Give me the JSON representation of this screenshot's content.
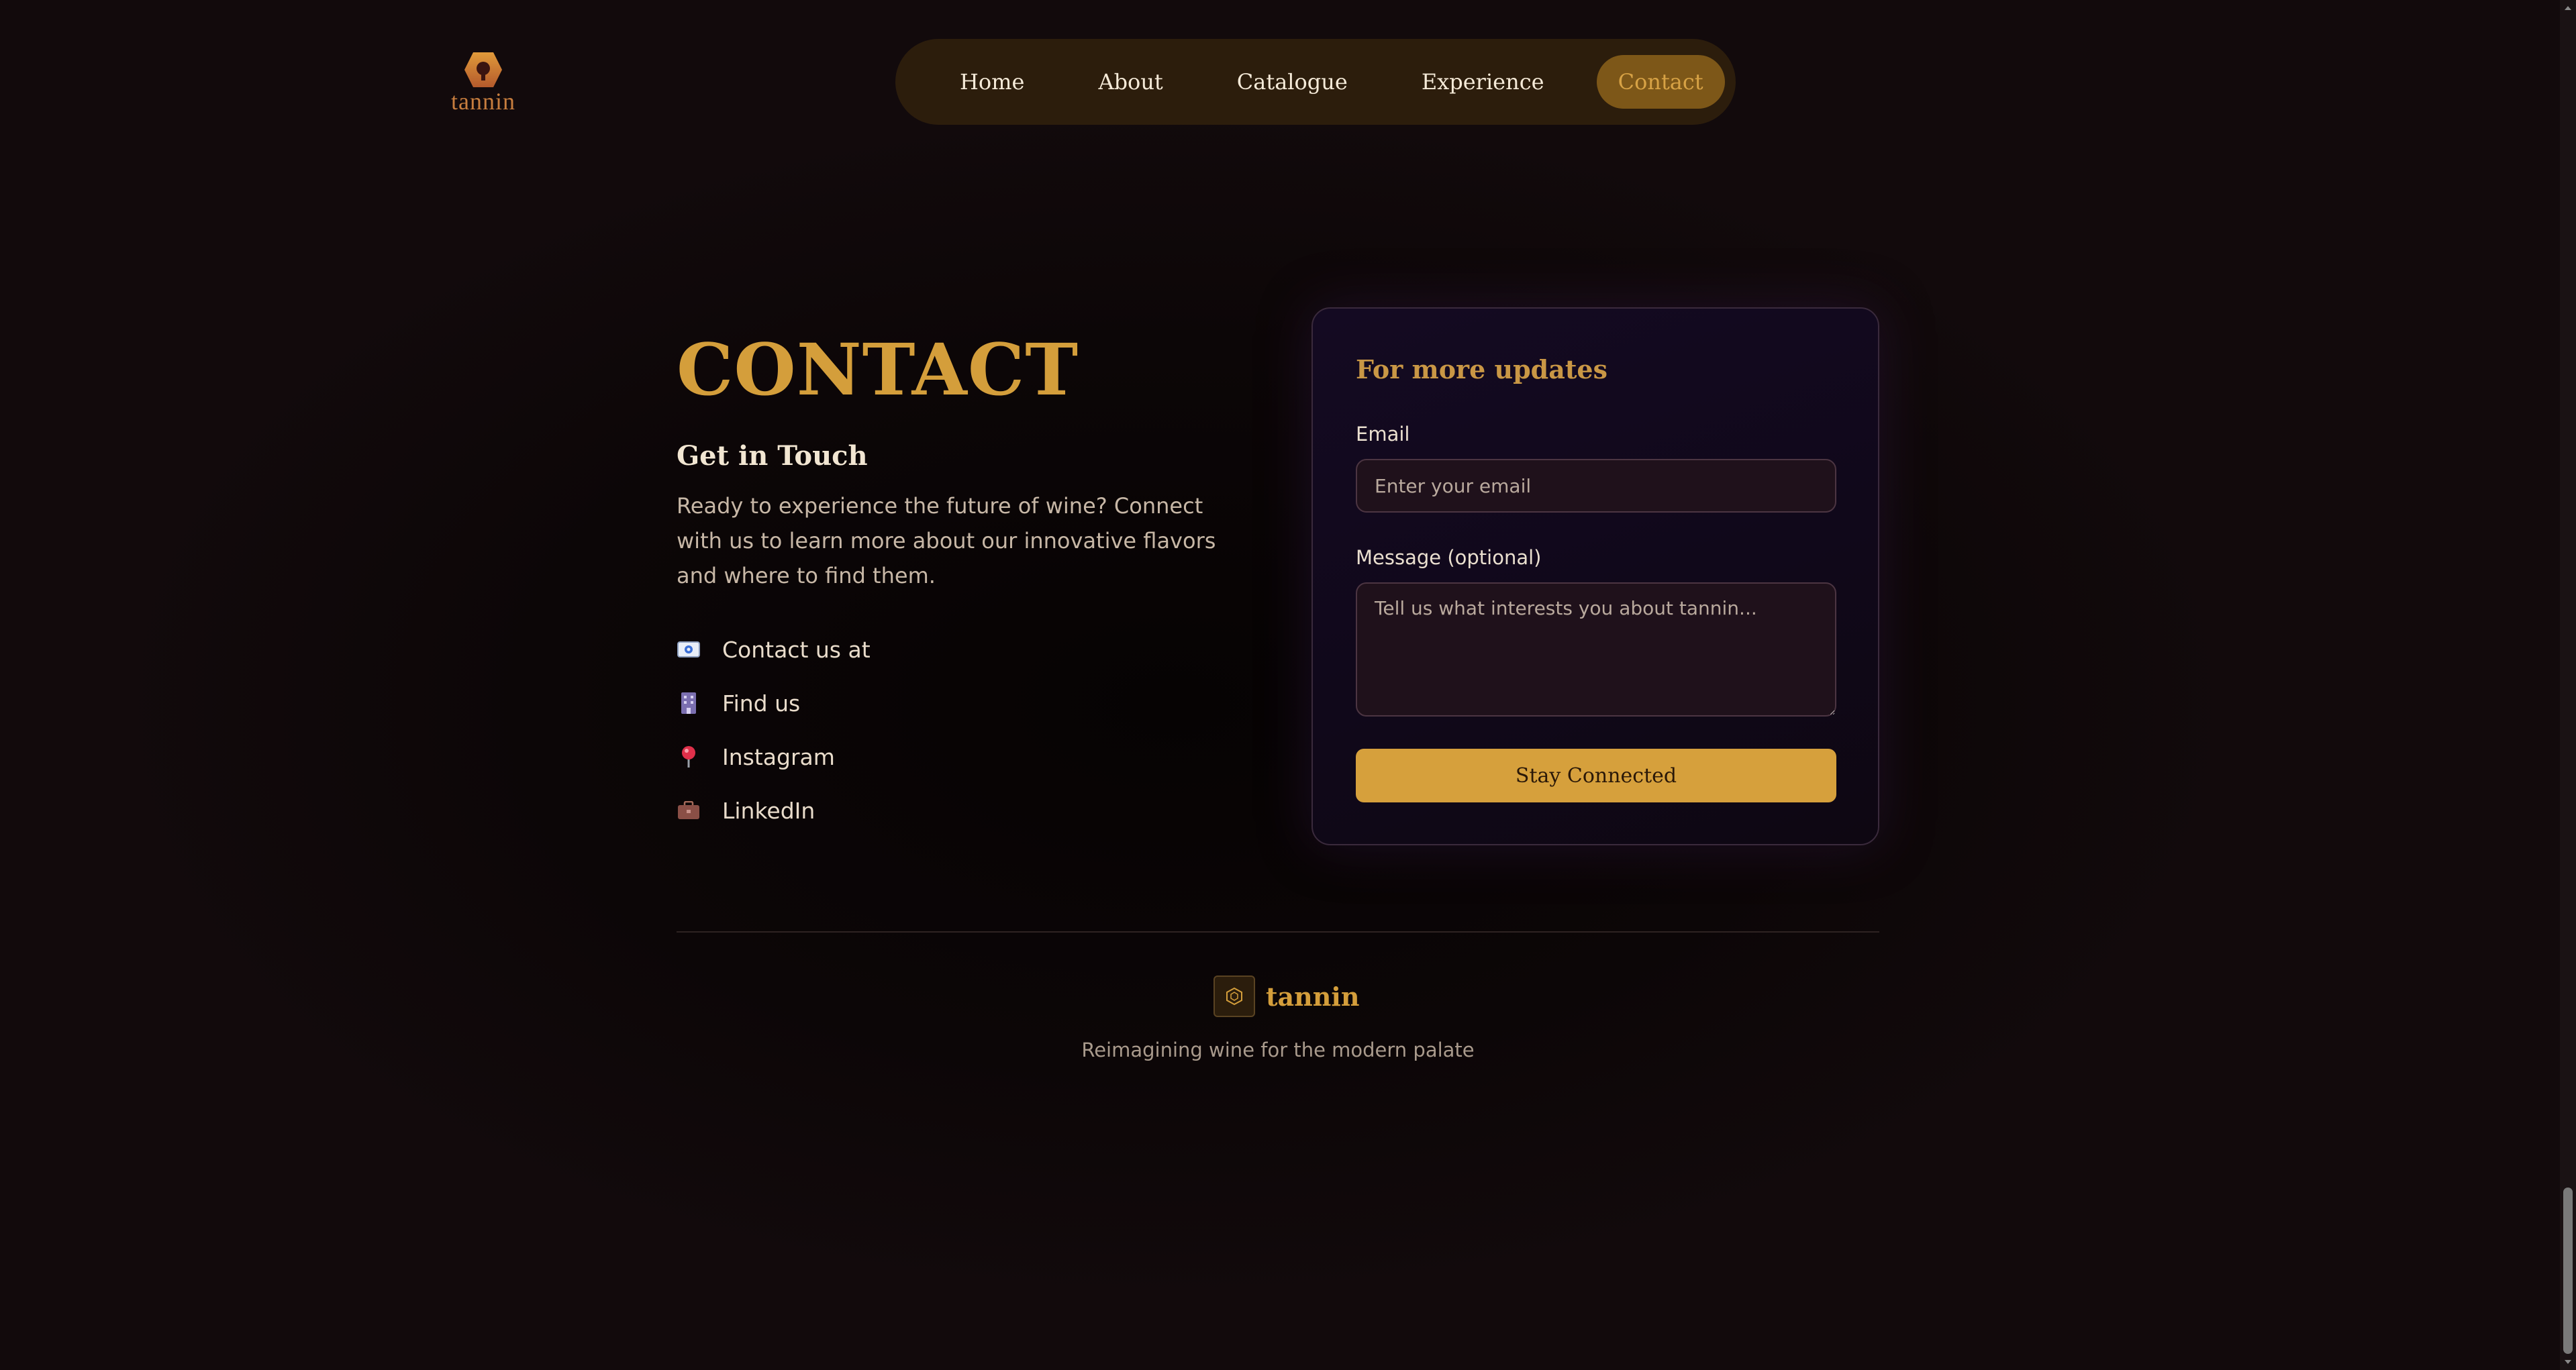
{
  "brand": {
    "name": "tannin"
  },
  "nav": {
    "items": [
      {
        "label": "Home"
      },
      {
        "label": "About"
      },
      {
        "label": "Catalogue"
      },
      {
        "label": "Experience"
      },
      {
        "label": "Contact"
      }
    ],
    "active": "Contact"
  },
  "contact": {
    "title": "CONTACT",
    "subtitle": "Get in Touch",
    "intro": "Ready to experience the future of wine? Connect with us to learn more about our innovative flavors and where to find them.",
    "links": [
      {
        "label": "Contact us at",
        "icon": "envelope-icon"
      },
      {
        "label": "Find us",
        "icon": "building-icon"
      },
      {
        "label": "Instagram",
        "icon": "pin-icon"
      },
      {
        "label": "LinkedIn",
        "icon": "briefcase-icon"
      }
    ]
  },
  "form": {
    "title": "For more updates",
    "email_label": "Email",
    "email_placeholder": "Enter your email",
    "email_value": "",
    "message_label": "Message (optional)",
    "message_placeholder": "Tell us what interests you about tannin...",
    "message_value": "",
    "submit_label": "Stay Connected"
  },
  "footer": {
    "name": "tannin",
    "tagline": "Reimagining wine for the modern palate"
  },
  "colors": {
    "background": "#0f0708",
    "accent_gold": "#d49e3b",
    "nav_bg": "#2c1d0c",
    "nav_active_bg": "#7d5718",
    "card_bg": "#140a22",
    "button_bg": "#d6a03c"
  }
}
